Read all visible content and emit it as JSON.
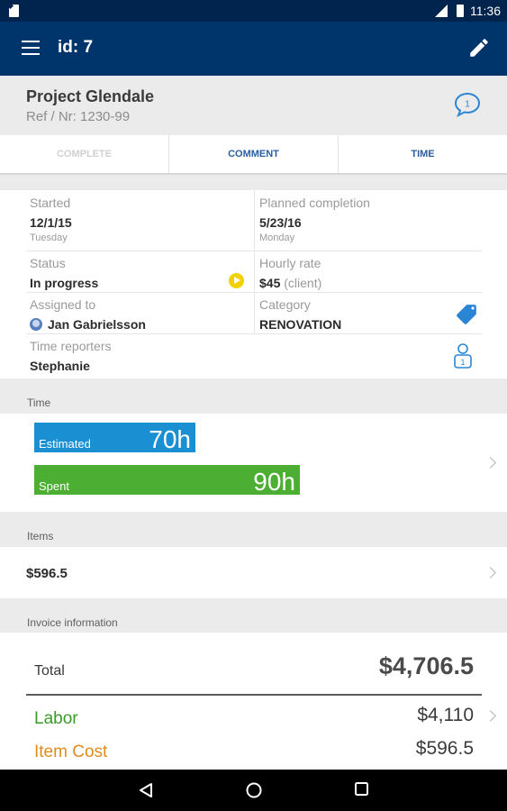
{
  "status_bar": {
    "time": "11:36"
  },
  "app_bar": {
    "title": "id: 7"
  },
  "project": {
    "name": "Project Glendale",
    "ref": "Ref / Nr: 1230-99",
    "comment_count": "1"
  },
  "tabs": [
    {
      "label": "COMPLETE",
      "enabled": false
    },
    {
      "label": "COMMENT",
      "enabled": true
    },
    {
      "label": "TIME",
      "enabled": true
    }
  ],
  "details": {
    "started": {
      "label": "Started",
      "value": "12/1/15",
      "sub": "Tuesday"
    },
    "planned": {
      "label": "Planned completion",
      "value": "5/23/16",
      "sub": "Monday"
    },
    "status": {
      "label": "Status",
      "value": "In progress"
    },
    "hourly": {
      "label": "Hourly rate",
      "value": "$45",
      "note": "(client)"
    },
    "assigned": {
      "label": "Assigned to",
      "value": "Jan Gabrielsson"
    },
    "category": {
      "label": "Category",
      "value": "RENOVATION"
    },
    "reporters": {
      "label": "Time reporters",
      "value": "Stephanie",
      "count": "1"
    }
  },
  "time_section": {
    "header": "Time",
    "estimated": {
      "label": "Estimated",
      "value": "70h",
      "hours": 70,
      "color": "#1a8fd1"
    },
    "spent": {
      "label": "Spent",
      "value": "90h",
      "hours": 90,
      "color": "#4cae32"
    }
  },
  "items_section": {
    "header": "Items",
    "value": "$596.5"
  },
  "invoice": {
    "header": "Invoice information",
    "total_label": "Total",
    "total_value": "$4,706.5",
    "labor_label": "Labor",
    "labor_value": "$4,110",
    "labor_color": "#3c9a2a",
    "item_label": "Item Cost",
    "item_value": "$596.5",
    "item_color": "#e08b1c"
  }
}
